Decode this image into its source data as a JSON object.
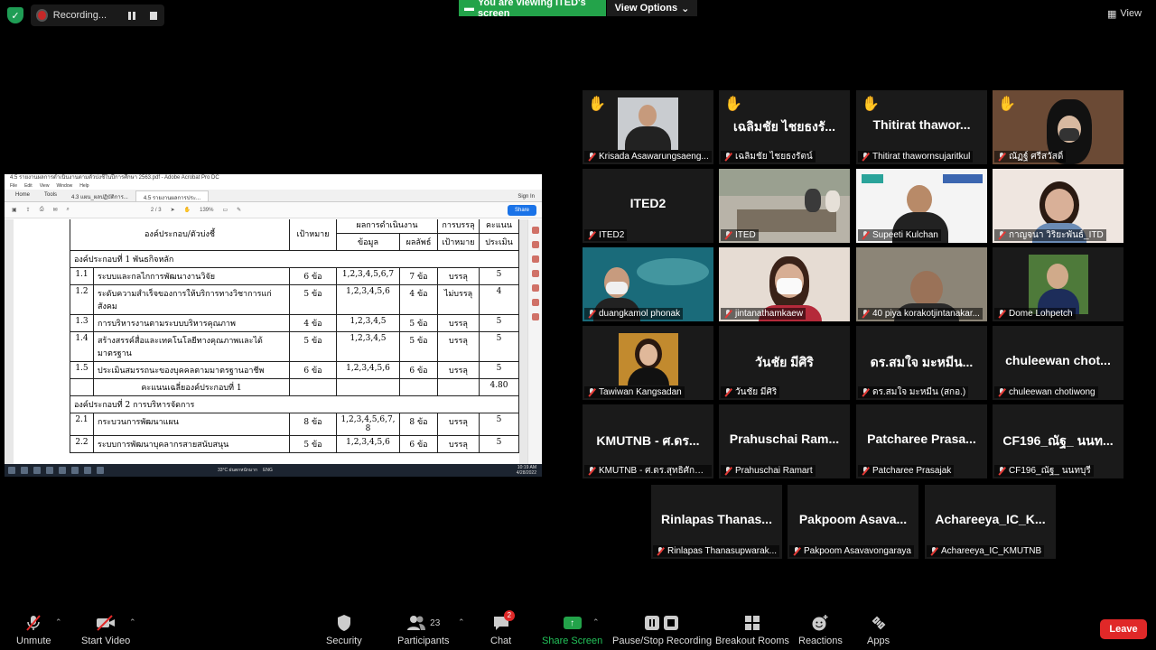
{
  "top": {
    "recording_label": "Recording...",
    "viewing_label": "You are viewing ITED's screen",
    "view_options_label": "View Options",
    "view_label": "View"
  },
  "shared": {
    "window_title": "4.5 รายงานผลการดำเนินงานตามตัวบ่งชี้ในปีการศึกษา 2563.pdf - Adobe Acrobat Pro DC",
    "menu": [
      "File",
      "Edit",
      "View",
      "Window",
      "Help"
    ],
    "tabs": [
      "Home",
      "Tools",
      "4.3 แผน_ผลปฏิบัติการ...",
      "4.5 รายงานผลการประ..."
    ],
    "sign_in": "Sign In",
    "page_indicator": "2 / 3",
    "zoom": "139%",
    "share_btn": "Share",
    "clock": "10:19 AM",
    "date": "4/28/2022",
    "temp": "33°C ฝนตกหนักมาก",
    "lang": "ENG",
    "table": {
      "h1": "องค์ประกอบ/ตัวบ่งชี้",
      "h2": "เป้าหมาย",
      "h3a": "ผลการดำเนินงาน",
      "h3b": "ข้อมูล",
      "h4": "ผลลัพธ์",
      "h5a": "การบรรลุ",
      "h5b": "เป้าหมาย",
      "h6a": "คะแนน",
      "h6b": "ประเมิน",
      "sec1": "องค์ประกอบที่ 1 พันธกิจหลัก",
      "rows1": [
        {
          "no": "1.1",
          "name": "ระบบและกลไกการพัฒนางานวิจัย",
          "target": "6 ข้อ",
          "data": "1,2,3,4,5,6,7",
          "result": "7 ข้อ",
          "achieve": "บรรลุ",
          "score": "5"
        },
        {
          "no": "1.2",
          "name": "ระดับความสำเร็จของการให้บริการทางวิชาการแก่สังคม",
          "target": "5 ข้อ",
          "data": "1,2,3,4,5,6",
          "result": "4 ข้อ",
          "achieve": "ไม่บรรลุ",
          "score": "4"
        },
        {
          "no": "1.3",
          "name": "การบริหารงานตามระบบบริหารคุณภาพ",
          "target": "4 ข้อ",
          "data": "1,2,3,4,5",
          "result": "5 ข้อ",
          "achieve": "บรรลุ",
          "score": "5"
        },
        {
          "no": "1.4",
          "name": "สร้างสรรค์สื่อและเทคโนโลยีทางคุณภาพและได้มาตรฐาน",
          "target": "5 ข้อ",
          "data": "1,2,3,4,5",
          "result": "5 ข้อ",
          "achieve": "บรรลุ",
          "score": "5"
        },
        {
          "no": "1.5",
          "name": "ประเมินสมรรถนะของบุคคลตามมาตรฐานอาชีพ",
          "target": "6 ข้อ",
          "data": "1,2,3,4,5,6",
          "result": "6 ข้อ",
          "achieve": "บรรลุ",
          "score": "5"
        }
      ],
      "avg1_label": "คะแนนเฉลี่ยองค์ประกอบที่ 1",
      "avg1_value": "4.80",
      "sec2": "องค์ประกอบที่ 2 การบริหารจัดการ",
      "rows2": [
        {
          "no": "2.1",
          "name": "กระบวนการพัฒนาแผน",
          "target": "8 ข้อ",
          "data": "1,2,3,4,5,6,7, 8",
          "result": "8 ข้อ",
          "achieve": "บรรลุ",
          "score": "5"
        },
        {
          "no": "2.2",
          "name": "ระบบการพัฒนาบุคลากรสายสนับสนุน",
          "target": "5 ข้อ",
          "data": "1,2,3,4,5,6",
          "result": "6 ข้อ",
          "achieve": "บรรลุ",
          "score": "5"
        }
      ]
    }
  },
  "tiles": [
    {
      "name": "Krisada Asawarungsaeng...",
      "big": "",
      "hand": true,
      "kind": "photo-suit"
    },
    {
      "name": "เฉลิมชัย ไชยธงรัตน์",
      "big": "เฉลิมชัย ไชยธงรั...",
      "hand": true,
      "kind": "text"
    },
    {
      "name": "Thitirat thawornsujaritkul",
      "big": "Thitirat thawor...",
      "hand": true,
      "kind": "text"
    },
    {
      "name": "ณัฏฐ์ ศรีสวัสดิ์",
      "big": "",
      "hand": true,
      "kind": "photo-woman"
    },
    {
      "name": "ITED2",
      "big": "ITED2",
      "hand": false,
      "kind": "text"
    },
    {
      "name": "ITED",
      "big": "",
      "hand": false,
      "kind": "photo-room"
    },
    {
      "name": "Supeeti Kulchan",
      "big": "",
      "hand": false,
      "kind": "photo-kmutnb"
    },
    {
      "name": "กาญจนา วิริยะพันธ์_ITD",
      "big": "",
      "hand": false,
      "kind": "photo-woman2"
    },
    {
      "name": "duangkamol phonak",
      "big": "",
      "hand": false,
      "kind": "photo-ocean"
    },
    {
      "name": "jintanathamkaew",
      "big": "",
      "hand": false,
      "kind": "photo-mask"
    },
    {
      "name": "40 piya korakotjintanakar...",
      "big": "",
      "hand": false,
      "kind": "photo-man"
    },
    {
      "name": "Dome Lohpetch",
      "big": "",
      "hand": false,
      "kind": "photo-dome"
    },
    {
      "name": "Tawiwan Kangsadan",
      "big": "",
      "hand": false,
      "kind": "photo-tawi"
    },
    {
      "name": "วันชัย มีศิริ",
      "big": "วันชัย มีศิริ",
      "hand": false,
      "kind": "text"
    },
    {
      "name": "ดร.สมใจ มะหมีน (สกอ.)",
      "big": "ดร.สมใจ มะหมีน...",
      "hand": false,
      "kind": "text"
    },
    {
      "name": "chuleewan chotiwong",
      "big": "chuleewan   chot...",
      "hand": false,
      "kind": "text"
    },
    {
      "name": "KMUTNB - ศ.ดร.สุทธิศักดิ์ พ...",
      "big": "KMUTNB - ศ.ดร...",
      "hand": false,
      "kind": "text"
    },
    {
      "name": "Prahuschai Ramart",
      "big": "Prahuschai  Ram...",
      "hand": false,
      "kind": "text"
    },
    {
      "name": "Patcharee Prasajak",
      "big": "Patcharee  Prasa...",
      "hand": false,
      "kind": "text"
    },
    {
      "name": "CF196_ณัฐ_ นนทบุรี",
      "big": "CF196_ณัฐ_ นนท...",
      "hand": false,
      "kind": "text"
    },
    {
      "name": "Rinlapas Thanasupwarak...",
      "big": "Rinlapas  Thanas...",
      "hand": false,
      "kind": "text"
    },
    {
      "name": "Pakpoom Asavavongaraya",
      "big": "Pakpoom  Asava...",
      "hand": false,
      "kind": "text"
    },
    {
      "name": "Achareeya_IC_KMUTNB",
      "big": "Achareeya_IC_K...",
      "hand": false,
      "kind": "text"
    }
  ],
  "toolbar": {
    "unmute": "Unmute",
    "start_video": "Start Video",
    "security": "Security",
    "participants": "Participants",
    "participants_count": "23",
    "chat": "Chat",
    "chat_badge": "2",
    "share_screen": "Share Screen",
    "pause_recording": "Pause/Stop Recording",
    "breakout": "Breakout Rooms",
    "reactions": "Reactions",
    "apps": "Apps",
    "leave": "Leave"
  },
  "colors": {
    "accent_green": "#23a34a",
    "leave_red": "#e02828",
    "active_speaker": "#f2d200"
  }
}
